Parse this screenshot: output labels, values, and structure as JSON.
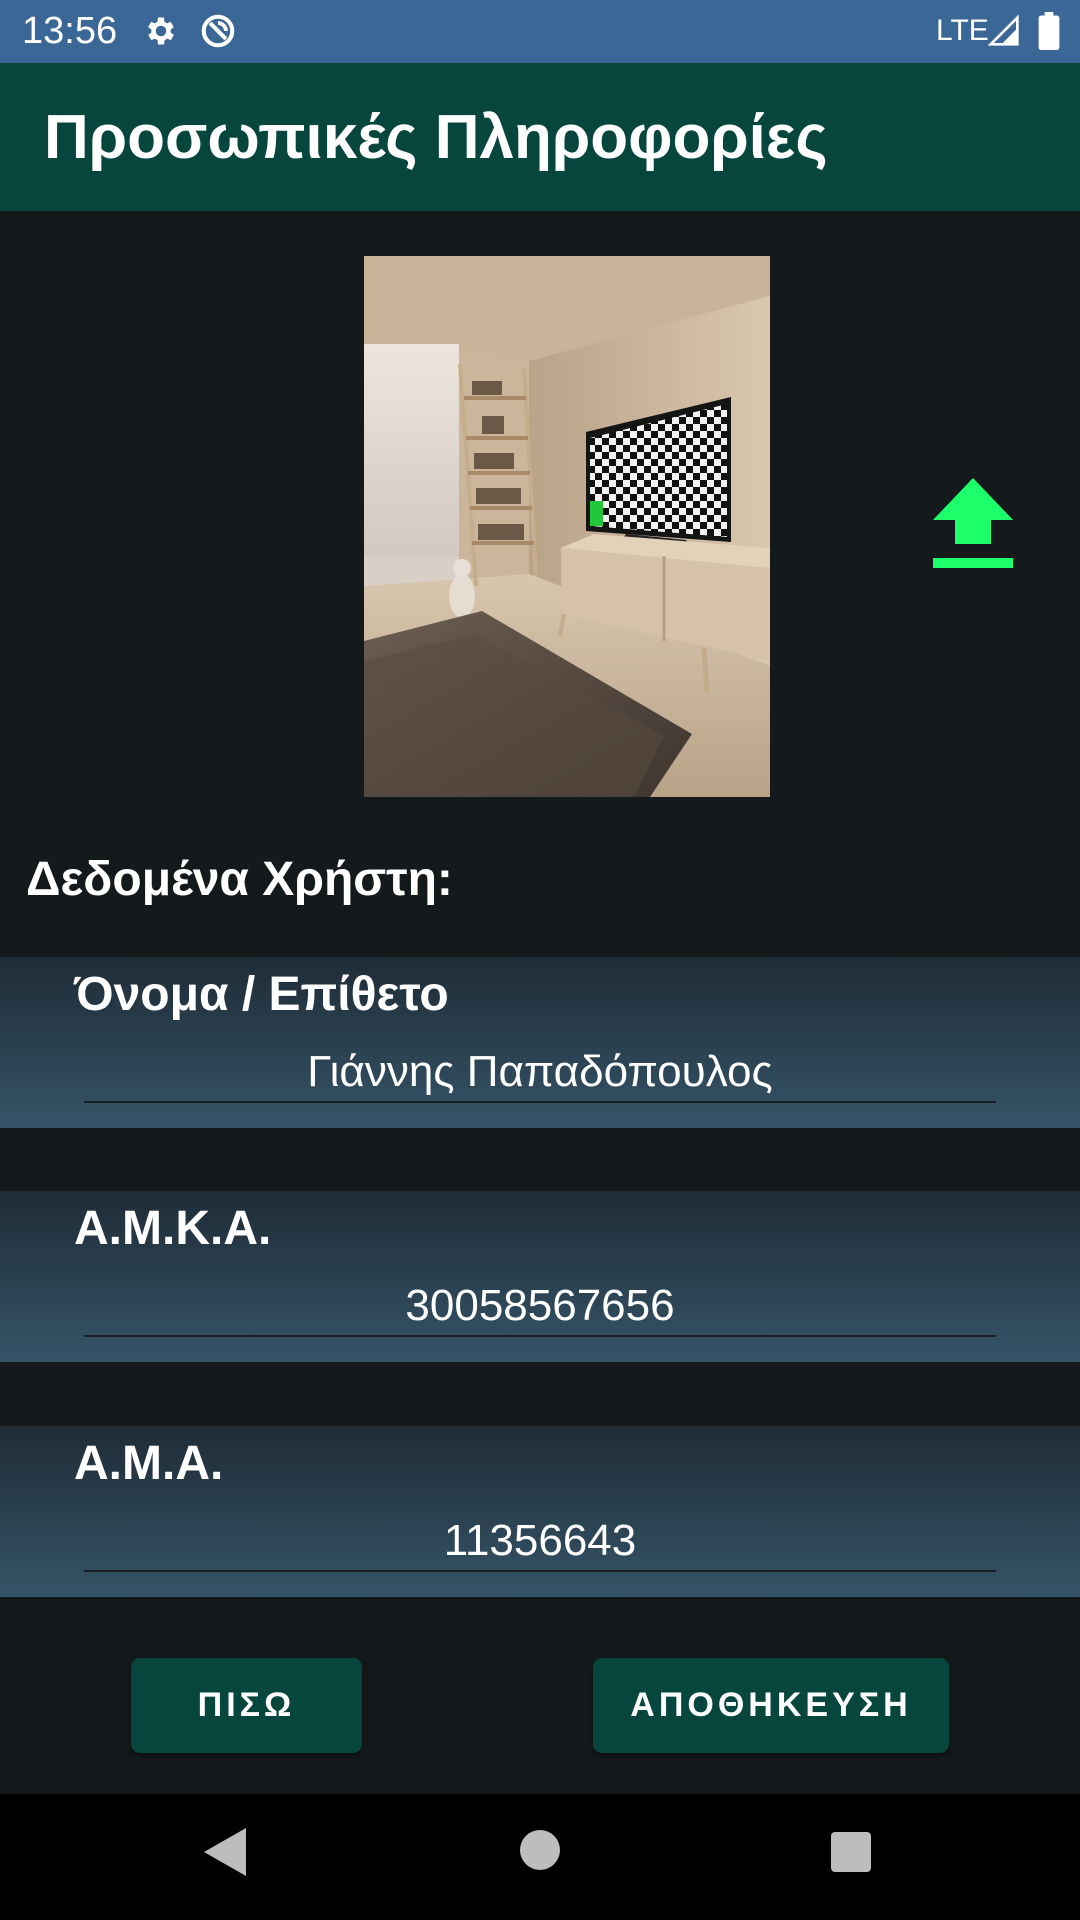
{
  "status_bar": {
    "time": "13:56",
    "network": "LTE",
    "icons": [
      "gear-icon",
      "sync-icon",
      "signal-icon",
      "battery-icon"
    ]
  },
  "app_bar": {
    "title": "Προσωπικές Πληροφορίες",
    "color": "#07463c"
  },
  "profile": {
    "photo_icon": "room-photo",
    "upload_icon": "upload-icon",
    "upload_color": "#1cff6a"
  },
  "section": {
    "title": "Δεδομένα Χρήστη:"
  },
  "fields": {
    "name": {
      "label": "Όνομα / Επίθετο",
      "value": "Γιάννης Παπαδόπουλος"
    },
    "amka": {
      "label": "Α.Μ.Κ.Α.",
      "value": "30058567656"
    },
    "ama": {
      "label": "Α.Μ.Α.",
      "value": "11356643"
    }
  },
  "buttons": {
    "back": "ΠΙΣΩ",
    "save": "ΑΠΟΘΗΚΕΥΣΗ"
  },
  "nav_bar": {
    "icons": [
      "back-icon",
      "home-icon",
      "recents-icon"
    ]
  }
}
